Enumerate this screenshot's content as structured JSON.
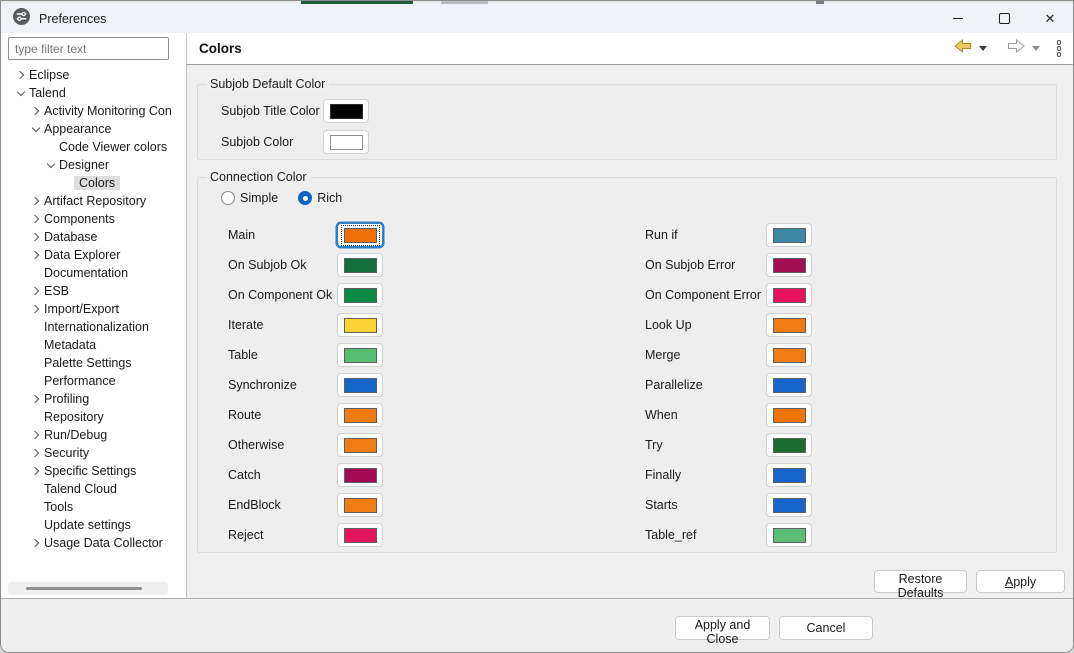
{
  "window": {
    "title": "Preferences",
    "controls": {
      "close_glyph": "✕"
    }
  },
  "sidebar": {
    "filter_placeholder": "type filter text",
    "tree": [
      {
        "label": "Eclipse",
        "level": 0,
        "arrow": "collapsed"
      },
      {
        "label": "Talend",
        "level": 0,
        "arrow": "expanded"
      },
      {
        "label": "Activity Monitoring Con",
        "level": 1,
        "arrow": "collapsed"
      },
      {
        "label": "Appearance",
        "level": 1,
        "arrow": "expanded"
      },
      {
        "label": "Code Viewer colors",
        "level": 2,
        "arrow": "none"
      },
      {
        "label": "Designer",
        "level": 2,
        "arrow": "expanded"
      },
      {
        "label": "Colors",
        "level": 3,
        "arrow": "none",
        "selected": true
      },
      {
        "label": "Artifact Repository",
        "level": 1,
        "arrow": "collapsed"
      },
      {
        "label": "Components",
        "level": 1,
        "arrow": "collapsed"
      },
      {
        "label": "Database",
        "level": 1,
        "arrow": "collapsed"
      },
      {
        "label": "Data Explorer",
        "level": 1,
        "arrow": "collapsed"
      },
      {
        "label": "Documentation",
        "level": 1,
        "arrow": "none"
      },
      {
        "label": "ESB",
        "level": 1,
        "arrow": "collapsed"
      },
      {
        "label": "Import/Export",
        "level": 1,
        "arrow": "collapsed"
      },
      {
        "label": "Internationalization",
        "level": 1,
        "arrow": "none"
      },
      {
        "label": "Metadata",
        "level": 1,
        "arrow": "none"
      },
      {
        "label": "Palette Settings",
        "level": 1,
        "arrow": "none"
      },
      {
        "label": "Performance",
        "level": 1,
        "arrow": "none"
      },
      {
        "label": "Profiling",
        "level": 1,
        "arrow": "collapsed"
      },
      {
        "label": "Repository",
        "level": 1,
        "arrow": "none"
      },
      {
        "label": "Run/Debug",
        "level": 1,
        "arrow": "collapsed"
      },
      {
        "label": "Security",
        "level": 1,
        "arrow": "collapsed"
      },
      {
        "label": "Specific Settings",
        "level": 1,
        "arrow": "collapsed"
      },
      {
        "label": "Talend Cloud",
        "level": 1,
        "arrow": "none"
      },
      {
        "label": "Tools",
        "level": 1,
        "arrow": "none"
      },
      {
        "label": "Update settings",
        "level": 1,
        "arrow": "none"
      },
      {
        "label": "Usage Data Collector",
        "level": 1,
        "arrow": "collapsed"
      }
    ]
  },
  "main": {
    "page_title": "Colors",
    "toolbar": {
      "icons": [
        "back-arrow",
        "back-dropdown",
        "forward-arrow",
        "forward-dropdown",
        "view-menu"
      ]
    },
    "subjob_group": {
      "title": "Subjob Default Color",
      "rows": [
        {
          "label": "Subjob Title Color",
          "color": "#000000",
          "chip_border": "#2b2b2b"
        },
        {
          "label": "Subjob Color",
          "color": "#ffffff",
          "chip_border": "#909090"
        }
      ]
    },
    "connection_group": {
      "title": "Connection Color",
      "radios": [
        {
          "label": "Simple",
          "selected": false
        },
        {
          "label": "Rich",
          "selected": true
        }
      ],
      "left_rows": [
        {
          "label": "Main",
          "color": "#ee7107",
          "focused": true
        },
        {
          "label": "On Subjob Ok",
          "color": "#156f3a"
        },
        {
          "label": "On Component Ok",
          "color": "#0a8a43"
        },
        {
          "label": "Iterate",
          "color": "#fbd335"
        },
        {
          "label": "Table",
          "color": "#56bd71"
        },
        {
          "label": "Synchronize",
          "color": "#1565cd"
        },
        {
          "label": "Route",
          "color": "#ef7d14"
        },
        {
          "label": "Otherwise",
          "color": "#ef7d14"
        },
        {
          "label": "Catch",
          "color": "#a30a52"
        },
        {
          "label": "EndBlock",
          "color": "#ef7d14"
        },
        {
          "label": "Reject",
          "color": "#e3155e"
        }
      ],
      "right_rows": [
        {
          "label": "Run if",
          "color": "#3d87a5"
        },
        {
          "label": "On Subjob Error",
          "color": "#a40e53"
        },
        {
          "label": "On Component Error",
          "color": "#e8125f"
        },
        {
          "label": "Look Up",
          "color": "#ef7d14"
        },
        {
          "label": "Merge",
          "color": "#ef7d14"
        },
        {
          "label": "Parallelize",
          "color": "#1565cd"
        },
        {
          "label": "When",
          "color": "#ef7408"
        },
        {
          "label": "Try",
          "color": "#1c6b30"
        },
        {
          "label": "Finally",
          "color": "#1565cd"
        },
        {
          "label": "Starts",
          "color": "#1565cd"
        },
        {
          "label": "Table_ref",
          "color": "#5cbe76"
        }
      ]
    },
    "buttons": {
      "restore_defaults": {
        "label": "Restore Defaults",
        "mnemonic": "D"
      },
      "apply": {
        "label": "Apply",
        "mnemonic": "A"
      }
    }
  },
  "footer": {
    "apply_and_close": "Apply and Close",
    "cancel": "Cancel"
  },
  "colors": {
    "accent": "#0f63c5",
    "selection_bg": "#dedede",
    "panel_bg": "#f0f0f0",
    "titlebar_bg": "#eff3f9",
    "back_arrow_fill": "#ecca63"
  }
}
